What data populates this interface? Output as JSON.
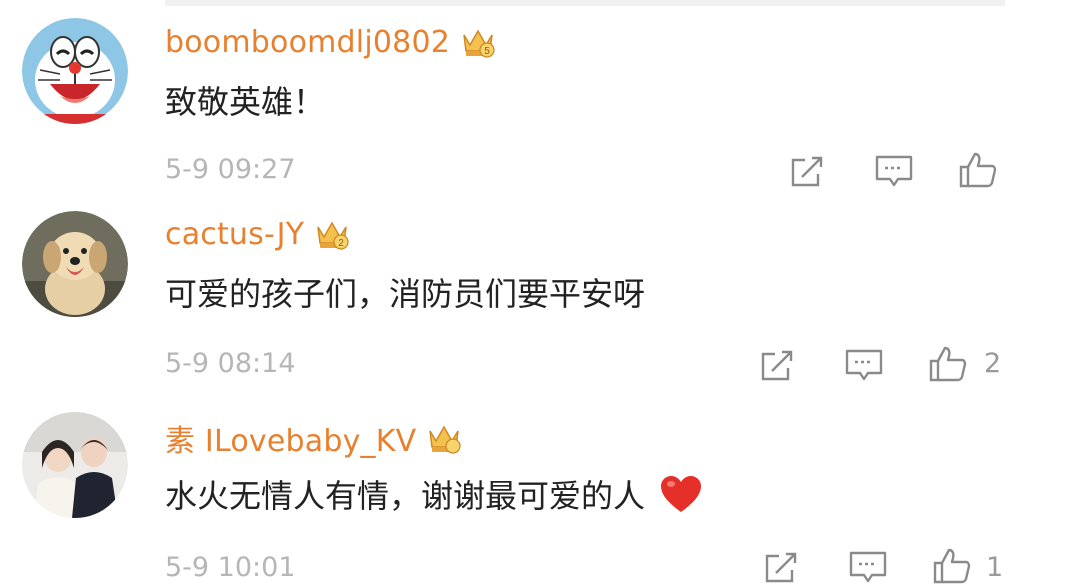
{
  "comments": [
    {
      "username": "boomboomdlj0802",
      "avatar": "doraemon-avatar",
      "badge_icon": "crown-icon",
      "text": "致敬英雄！",
      "timestamp": "5-9 09:27",
      "likes": ""
    },
    {
      "username": "cactus-JY",
      "avatar": "dog-photo-avatar",
      "badge_icon": "crown-icon",
      "text": "可爱的孩子们，消防员们要平安呀",
      "timestamp": "5-9 08:14",
      "likes": "2"
    },
    {
      "username": "素 ILovebaby_KV",
      "avatar": "couple-photo-avatar",
      "badge_icon": "crown-icon",
      "text": "水火无情人有情，谢谢最可爱的人",
      "emoji": "red-heart-icon",
      "timestamp": "5-9 10:01",
      "likes": "1"
    }
  ],
  "actions": [
    "share-icon",
    "reply-icon",
    "like-icon"
  ],
  "colors": {
    "username": "#e8812f",
    "crown": "#e8a33a",
    "text": "#222222",
    "meta": "#b6b6b6",
    "icon": "#8a8a8a",
    "heart": "#e5302a"
  }
}
